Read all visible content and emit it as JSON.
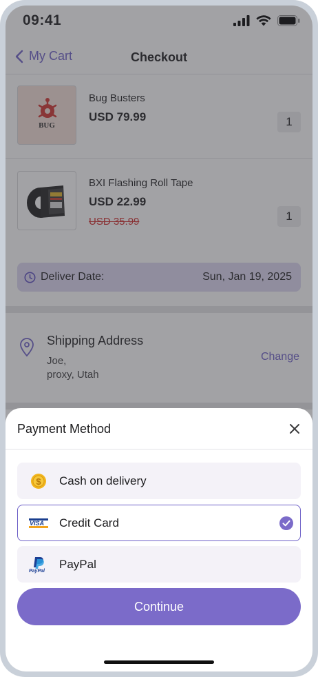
{
  "status_bar": {
    "time": "09:41"
  },
  "nav": {
    "back_label": "My Cart",
    "title": "Checkout"
  },
  "cart": {
    "items": [
      {
        "name": "Bug Busters",
        "price": "USD 79.99",
        "quantity": "1",
        "image_text": "BUG"
      },
      {
        "name": "BXI Flashing Roll Tape",
        "price": "USD 22.99",
        "original_price": "USD 35.99",
        "quantity": "1"
      }
    ],
    "deliver_label": "Deliver Date:",
    "deliver_date": "Sun, Jan 19, 2025"
  },
  "shipping": {
    "title": "Shipping Address",
    "name": "Joe,",
    "location": "proxy, Utah",
    "change_label": "Change"
  },
  "payment_sheet": {
    "title": "Payment Method",
    "options": [
      {
        "label": "Cash on delivery",
        "icon": "coin-icon",
        "selected": false
      },
      {
        "label": "Credit Card",
        "icon": "visa-icon",
        "icon_text": "VISA",
        "selected": true
      },
      {
        "label": "PayPal",
        "icon": "paypal-icon",
        "icon_text": "PayPal",
        "selected": false
      }
    ],
    "continue_label": "Continue"
  },
  "colors": {
    "accent": "#7b6bc9",
    "link": "#6c5fc7",
    "sale": "#d02a2a"
  }
}
